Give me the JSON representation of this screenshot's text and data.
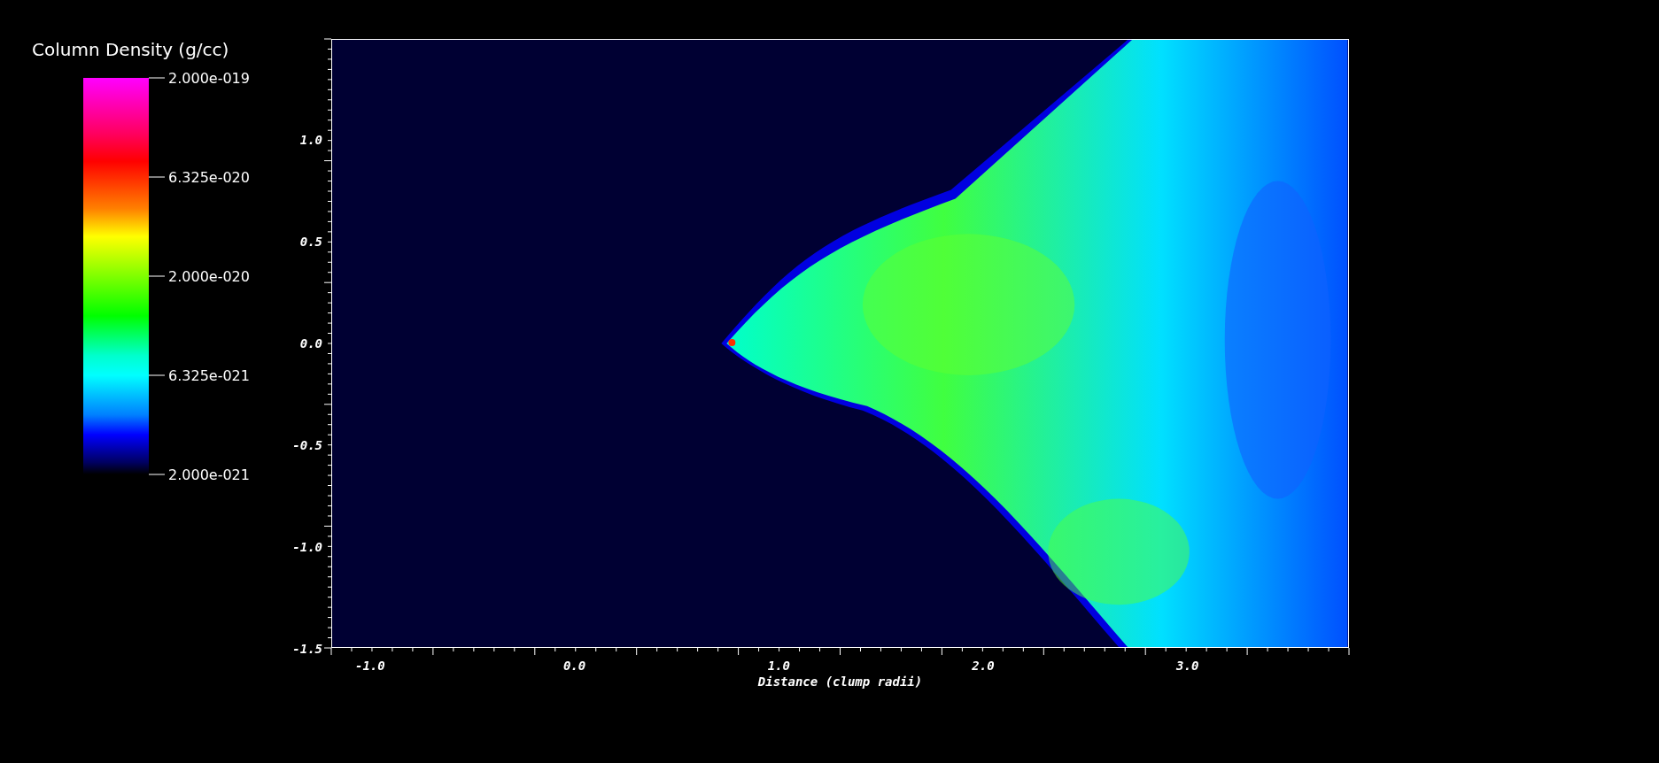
{
  "legend": {
    "title": "Column Density (g/cc)",
    "labels": [
      "2.000e-019",
      "6.325e-020",
      "2.000e-020",
      "6.325e-021",
      "2.000e-021"
    ]
  },
  "plot": {
    "y_ticks": [
      "1.0",
      "0.5",
      "0.0",
      "-0.5",
      "-1.0",
      "-1.5"
    ],
    "x_ticks": [
      "-1.0",
      "0.0",
      "1.0",
      "2.0",
      "3.0"
    ],
    "x_label": "Distance (clump radii)"
  }
}
